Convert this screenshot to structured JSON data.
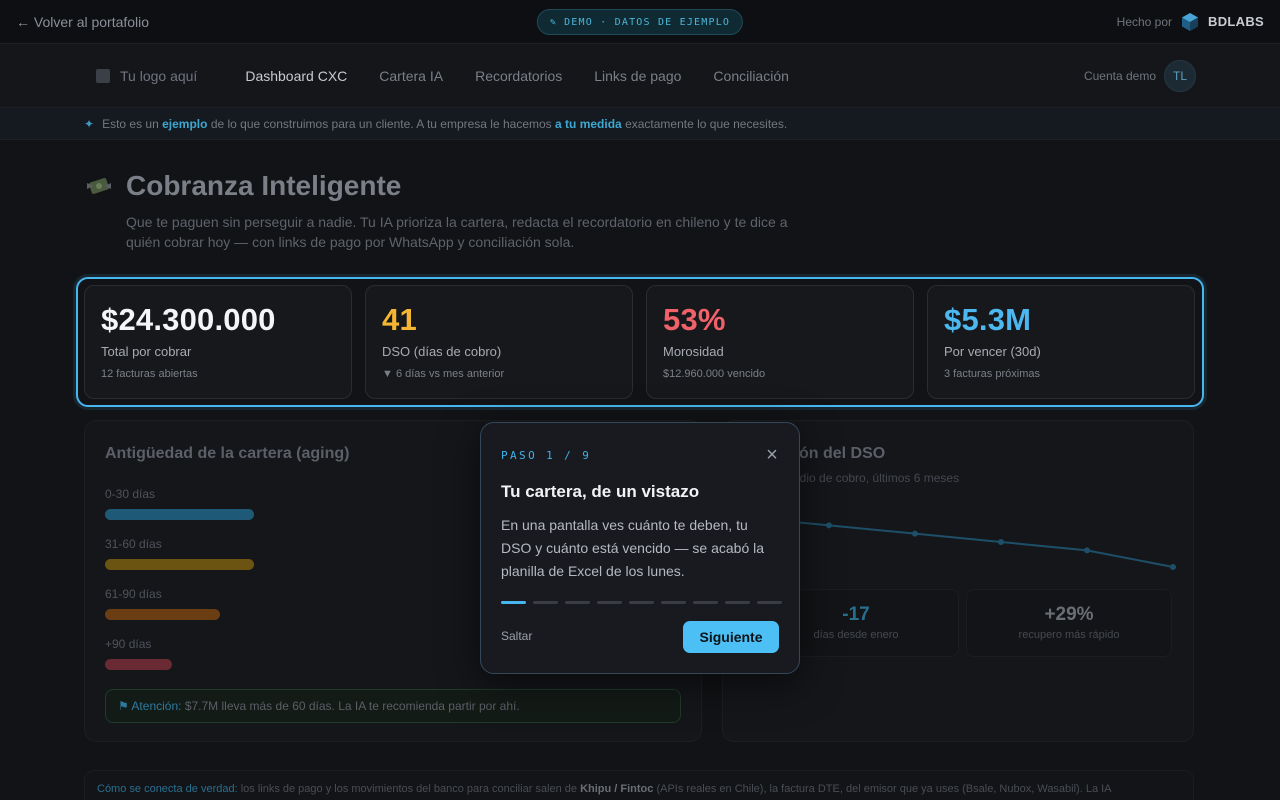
{
  "topbar": {
    "back_label": "← Volver al portafolio",
    "demo_badge": "DEMO · DATOS DE EJEMPLO",
    "made_by": "Hecho por",
    "brand": "BDLABS"
  },
  "nav": {
    "logo_placeholder": "Tu logo aquí",
    "tabs": [
      "Dashboard CXC",
      "Cartera IA",
      "Recordatorios",
      "Links de pago",
      "Conciliación"
    ],
    "active_tab": "Dashboard CXC",
    "account_label": "Cuenta demo",
    "avatar_initials": "TL"
  },
  "banner": {
    "part1": "Esto es un",
    "hl1": "ejemplo",
    "part2": "de lo que construimos para un cliente. A tu empresa le hacemos",
    "hl2": "a tu medida",
    "part3": "exactamente lo que necesites."
  },
  "hero": {
    "title": "Cobranza Inteligente",
    "subtitle": "Que te paguen sin perseguir a nadie. Tu IA prioriza la cartera, redacta el recordatorio en chileno y te dice a quién cobrar hoy — con links de pago por WhatsApp y conciliación sola."
  },
  "kpis": [
    {
      "value": "$24.300.000",
      "label": "Total por cobrar",
      "foot": "12 facturas abiertas",
      "color": "#f4f5f7"
    },
    {
      "value": "41",
      "label": "DSO (días de cobro)",
      "foot": "▼ 6 días vs mes anterior",
      "color": "#f5b731"
    },
    {
      "value": "53%",
      "label": "Morosidad",
      "foot": "$12.960.000 vencido",
      "color": "#f0616a"
    },
    {
      "value": "$5.3M",
      "label": "Por vencer (30d)",
      "foot": "3 facturas próximas",
      "color": "#4cb8ef"
    }
  ],
  "aging": {
    "title": "Antigüedad de la cartera (aging)",
    "buckets": [
      {
        "label": "0-30 días",
        "share": 0.31,
        "color": "#1e5a78"
      },
      {
        "label": "31-60 días",
        "share": 0.31,
        "color": "#6b5412"
      },
      {
        "label": "61-90 días",
        "share": 0.24,
        "color": "#6a3d12"
      },
      {
        "label": "+90 días",
        "share": 0.14,
        "color": "#6a2a33"
      }
    ],
    "alert_hl": "⚑ Atención:",
    "alert_text": "$7.7M lleva más de 60 días. La IA te recomienda partir por ahí."
  },
  "dso": {
    "title_visible": "ón del DSO",
    "subtitle_visible": "edio de cobro, últimos 6 meses",
    "trend": [
      47,
      46,
      45,
      44,
      43,
      41
    ],
    "stats": [
      {
        "value": "-17",
        "label": "días desde enero",
        "color": "#2a6f90"
      },
      {
        "value": "+29%",
        "label": "recupero más rápido",
        "color": "#6a6e75"
      }
    ]
  },
  "footer": {
    "hl": "Cómo se conecta de verdad:",
    "text1": "los links de pago y los movimientos del banco para conciliar salen de",
    "bold": "Khipu / Fintoc",
    "text2": "(APIs reales en Chile), la factura DTE, del emisor que ya uses (Bsale, Nubox, Wasabil). La IA"
  },
  "tour": {
    "step": "PASO 1 / 9",
    "step_index": 1,
    "step_total": 9,
    "title": "Tu cartera, de un vistazo",
    "body": "En una pantalla ves cuánto te deben, tu DSO y cuánto está vencido — se acabó la planilla de Excel de los lunes.",
    "skip": "Saltar",
    "next": "Siguiente"
  },
  "colors": {
    "accent": "#47b6ef",
    "background": "#121316"
  }
}
